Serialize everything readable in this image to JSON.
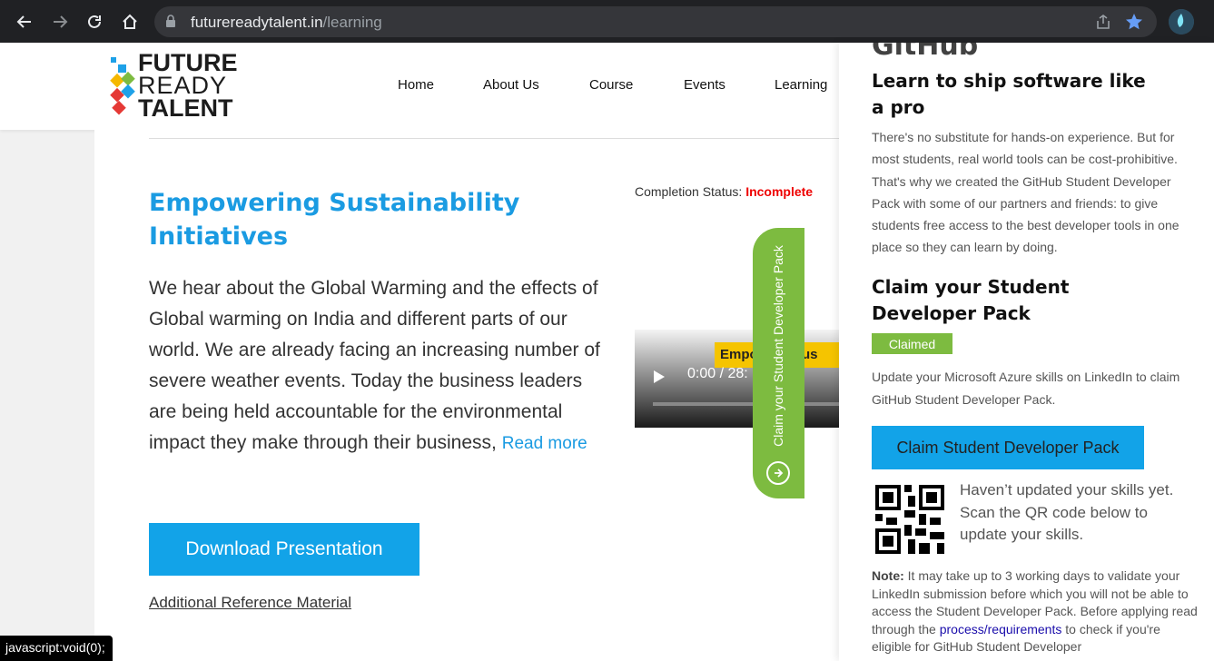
{
  "browser": {
    "url_host": "futurereadytalent.in",
    "url_path": "/learning",
    "icons": [
      "back-icon",
      "forward-icon",
      "reload-icon",
      "home-icon",
      "lock-icon",
      "share-icon",
      "star-icon"
    ]
  },
  "site": {
    "logo": {
      "line1": "FUTURE",
      "line2": "READY",
      "line3": "TALENT"
    },
    "nav": [
      "Home",
      "About Us",
      "Course",
      "Events",
      "Learning"
    ]
  },
  "main": {
    "title": "Empowering Sustainability Initiatives",
    "body": "We hear about the Global Warming and the effects of Global warming on India and different parts of our world. We are already facing an increasing number of severe weather events. Today the business leaders are being held accountable for the environmental impact they make through their business,",
    "read_more": "Read more",
    "download_button": "Download Presentation",
    "reference_link": "Additional Reference Material",
    "status_label": "Completion Status:",
    "status_value": "Incomplete",
    "video": {
      "time": "0:00 / 28:",
      "banner": "Empo",
      "banner2": "g Sus"
    }
  },
  "claim_tab": {
    "label": "Claim your Student Developer Pack"
  },
  "panel": {
    "github_logo": "GitHub",
    "heading_learn": "Learn to ship software like a pro",
    "intro": "There's no substitute for hands-on experience. But for most students, real world tools can be cost-prohibitive. That's why we created the GitHub Student Developer Pack with some of our partners and friends: to give students free access to the best developer tools in one place so they can learn by doing.",
    "heading_claim": "Claim your Student Developer Pack",
    "badge": "Claimed",
    "update_text": "Update your Microsoft Azure skills on LinkedIn to claim GitHub Student Developer Pack.",
    "claim_button": "Claim Student Developer Pack",
    "qr_text": "Haven’t updated your skills yet. Scan the QR code below to update your skills.",
    "note_label": "Note:",
    "note_text1": " It may take up to 3 working days to validate your LinkedIn submission before which you will not be able to access the Student Developer Pack. Before applying read through the ",
    "note_link": "process/requirements",
    "note_text2": " to check if you're eligible for GitHub Student Developer"
  },
  "statusbar": "javascript:void(0);",
  "colors": {
    "accent_blue": "#12a3e8",
    "green": "#7dbb40",
    "incomplete_red": "#ee0000"
  }
}
